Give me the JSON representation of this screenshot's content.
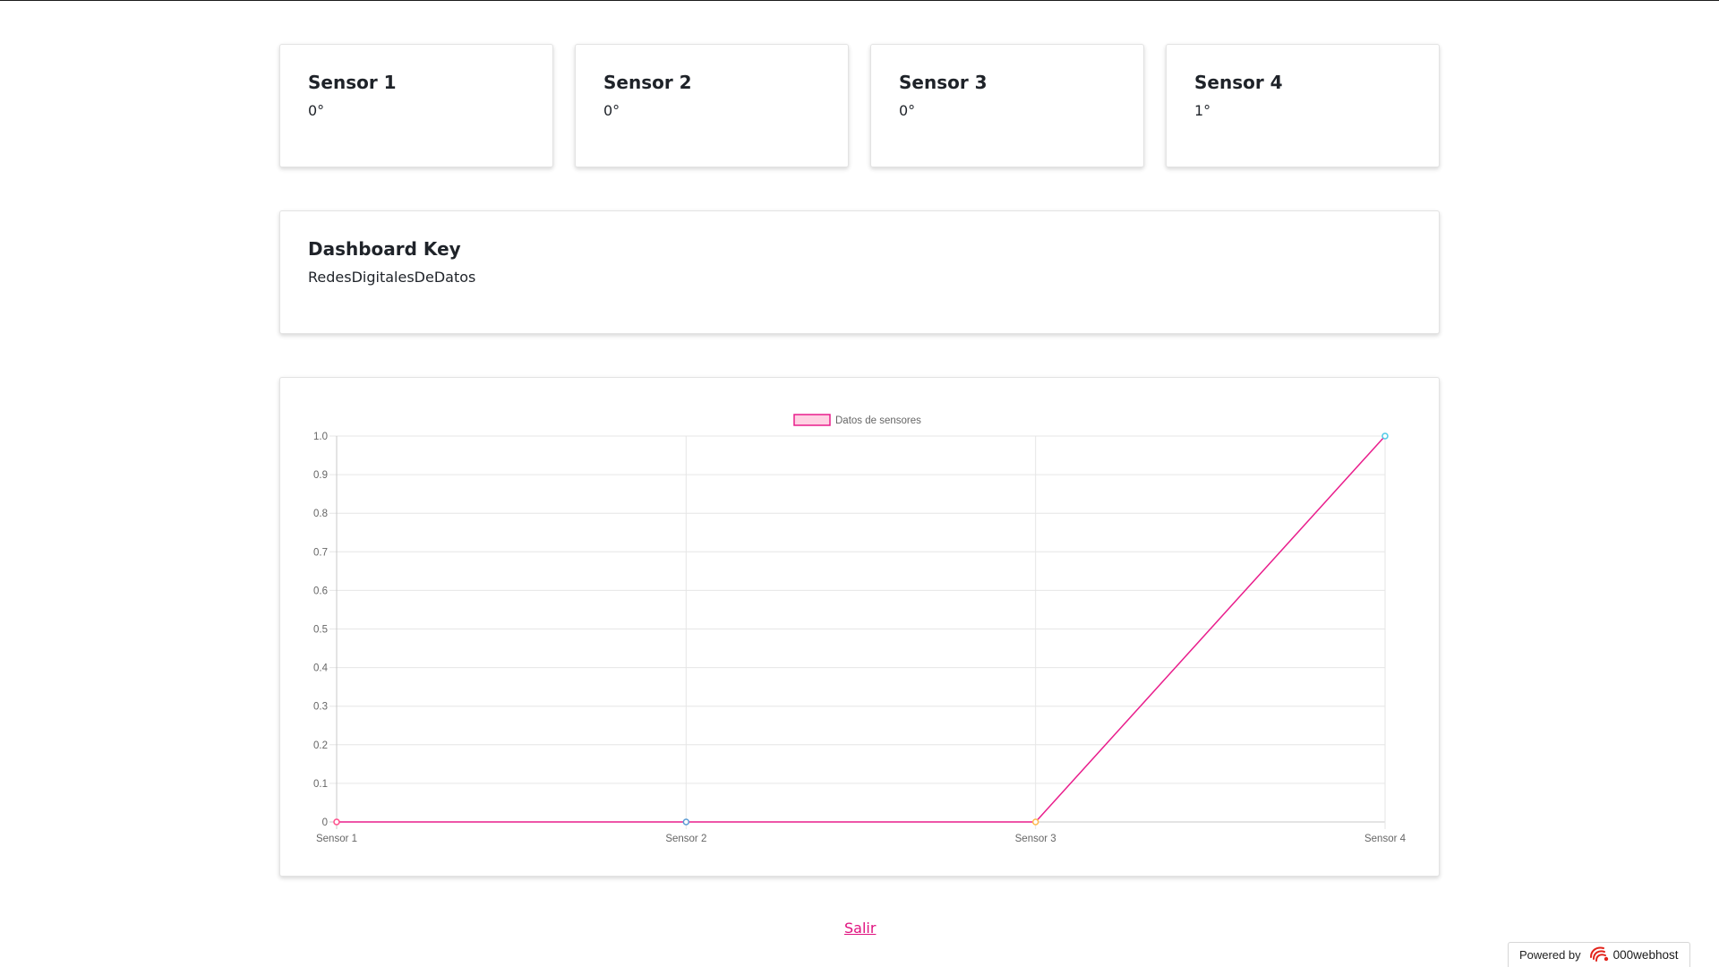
{
  "sensors": [
    {
      "title": "Sensor 1",
      "value": "0°"
    },
    {
      "title": "Sensor 2",
      "value": "0°"
    },
    {
      "title": "Sensor 3",
      "value": "0°"
    },
    {
      "title": "Sensor 4",
      "value": "1°"
    }
  ],
  "dashboard_key": {
    "title": "Dashboard Key",
    "value": "RedesDigitalesDeDatos"
  },
  "chart_data": {
    "type": "line",
    "categories": [
      "Sensor 1",
      "Sensor 2",
      "Sensor 3",
      "Sensor 4"
    ],
    "series": [
      {
        "name": "Datos de sensores",
        "values": [
          0,
          0,
          0,
          1
        ]
      }
    ],
    "point_colors": [
      "#ff4f8b",
      "#5b9bd5",
      "#ffb84d",
      "#4dc9e6"
    ],
    "line_color": "#e91e8c",
    "legend_fill": "#ffd1e3",
    "legend_position": "top",
    "ylim": [
      0,
      1
    ],
    "yticks": [
      "0",
      "0.1",
      "0.2",
      "0.3",
      "0.4",
      "0.5",
      "0.6",
      "0.7",
      "0.8",
      "0.9",
      "1.0"
    ],
    "grid": true,
    "title": "",
    "xlabel": "",
    "ylabel": ""
  },
  "footer": {
    "exit_label": "Salir",
    "powered_by": "Powered by",
    "brand": "000webhost"
  },
  "colors": {
    "accent": "#e0117f",
    "brand_icon": "#e2231a"
  },
  "icons": {
    "brand": "000webhost-logo-icon"
  }
}
